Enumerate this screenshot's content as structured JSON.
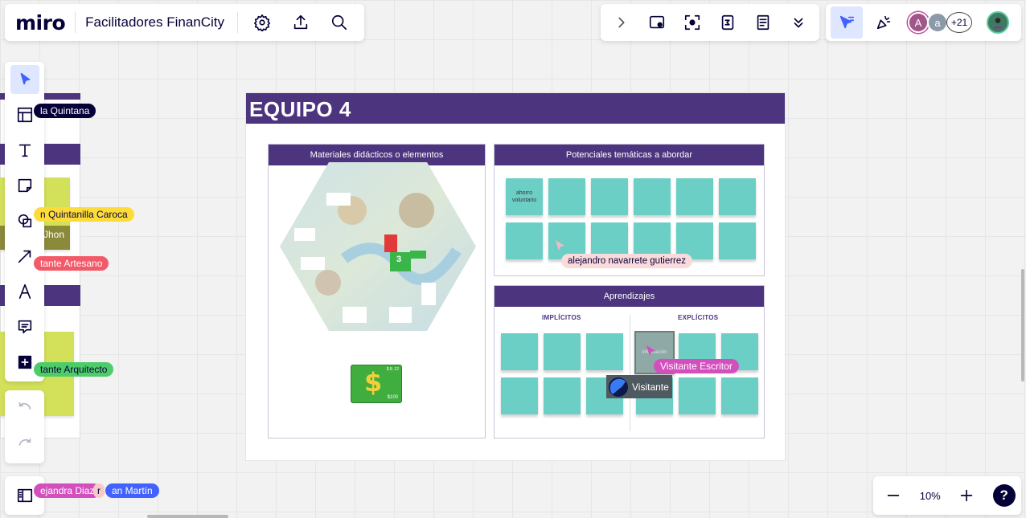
{
  "app": {
    "logo": "miro",
    "board_title": "Facilitadores FinanCity"
  },
  "collab": {
    "extra_count": "+21",
    "avatar1": "A",
    "avatar2": "a"
  },
  "zoom": {
    "level": "10%",
    "help": "?"
  },
  "frame": {
    "title": "EQUIPO 4",
    "sections": {
      "materials": "Materiales didácticos o elementos",
      "topics": "Potenciales temáticas a abordar",
      "learnings": "Aprendizajes",
      "implicit": "IMPLÍCITOS",
      "explicit": "EXPLÍCITOS"
    },
    "sticky_text": {
      "topic1": "ahorro voluntario",
      "learning1": "información"
    },
    "game_card": {
      "number": "3",
      "money": "$100",
      "top": "$ 8. 12"
    }
  },
  "cursors": {
    "c1": "la Quintana",
    "c2": "n Quintanilla Caroca",
    "c3": "Jhon",
    "c4": "tante Artesano",
    "c5": "tante Arquitecto",
    "c6": "ejandra Diaz",
    "c7": "r",
    "c8": "an Martín",
    "c9": "alejandro navarrete gutierrez",
    "c10": "Visitante Escritor",
    "c11": "Visitante"
  },
  "colors": {
    "accent": "#4c347f",
    "sticky": "#6ccfc6",
    "active_tool": "#4262ff"
  }
}
